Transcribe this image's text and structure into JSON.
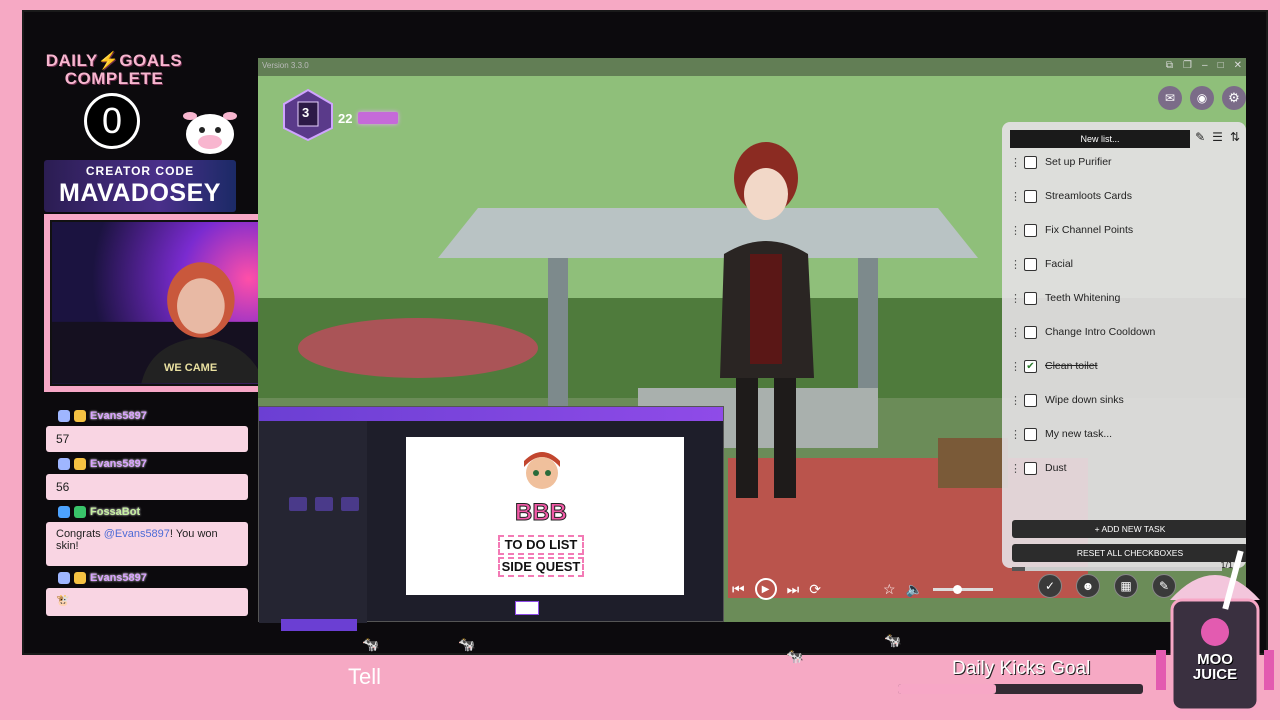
{
  "overlay": {
    "goals_title": "DAILY⚡GOALS COMPLETE",
    "goals_count": "0",
    "creator_label": "CREATOR CODE",
    "creator_code": "MAVADOSEY",
    "webcam_shirt": "WE CAME"
  },
  "chat": [
    {
      "user": "Evans5897",
      "text": "57"
    },
    {
      "user": "Evans5897",
      "text": "56"
    },
    {
      "user": "FossaBot",
      "text_pre": "Congrats ",
      "mention": "@Evans5897",
      "text_post": "! You won skin!"
    },
    {
      "user": "Evans5897",
      "text": ""
    }
  ],
  "game": {
    "version": "Version 3.3.0",
    "level": "3",
    "xp": "22",
    "todo": {
      "new_list_label": "New list...",
      "tasks": [
        {
          "label": "Set up Purifier",
          "done": false
        },
        {
          "label": "Streamloots Cards",
          "done": false
        },
        {
          "label": "Fix Channel Points",
          "done": false
        },
        {
          "label": "Facial",
          "done": false
        },
        {
          "label": "Teeth Whitening",
          "done": false
        },
        {
          "label": "Change Intro Cooldown",
          "done": false
        },
        {
          "label": "Clean toilet",
          "done": true
        },
        {
          "label": "Wipe down sinks",
          "done": false
        },
        {
          "label": "My new task...",
          "done": false
        },
        {
          "label": "Dust",
          "done": false
        }
      ],
      "progress": "1/17",
      "add_task": "+ ADD NEW TASK",
      "reset": "RESET ALL CHECKBOXES"
    }
  },
  "canva": {
    "title_big": "BBB",
    "line1": "TO DO LIST",
    "line2": "SIDE QUEST"
  },
  "footer": {
    "ticker": "Tell",
    "kicks_goal": "Daily Kicks Goal",
    "kicks_progress": 0.4,
    "moo_label": "MOO JUICE"
  },
  "colors": {
    "accent": "#f7a7c6",
    "frame": "#0c0a0d"
  }
}
